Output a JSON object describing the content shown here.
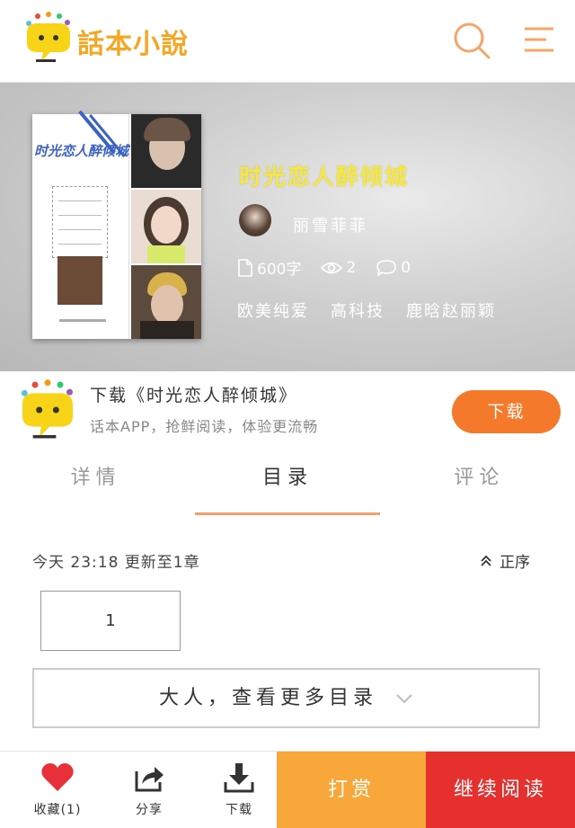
{
  "header": {
    "logo_text": "話本小說",
    "search_icon": "search-icon",
    "menu_icon": "menu-icon"
  },
  "book": {
    "title": "时光恋人醉倾城",
    "author": "丽雪菲菲",
    "words": "600字",
    "views": "2",
    "comments": "0",
    "tags": [
      "欧美纯爱",
      "高科技",
      "鹿晗赵丽颖"
    ]
  },
  "download_banner": {
    "title": "下载《时光恋人醉倾城》",
    "subtitle": "话本APP，抢鲜阅读，体验更流畅",
    "button": "下载"
  },
  "tabs": [
    {
      "label": "详情",
      "active": false
    },
    {
      "label": "目录",
      "active": true
    },
    {
      "label": "评论",
      "active": false
    }
  ],
  "catalog": {
    "update_text": "今天 23:18 更新至1章",
    "order_label": "正序",
    "page_number": "1",
    "more_label": "大人，查看更多目录"
  },
  "bottom_bar": {
    "favorite_label": "收藏(1)",
    "share_label": "分享",
    "download_label": "下载",
    "tip_label": "打赏",
    "read_label": "继续阅读"
  },
  "colors": {
    "brand": "#f5a623",
    "download": "#f5792a",
    "tip": "#f8a83a",
    "read": "#e5302d",
    "heart": "#e8303a"
  }
}
